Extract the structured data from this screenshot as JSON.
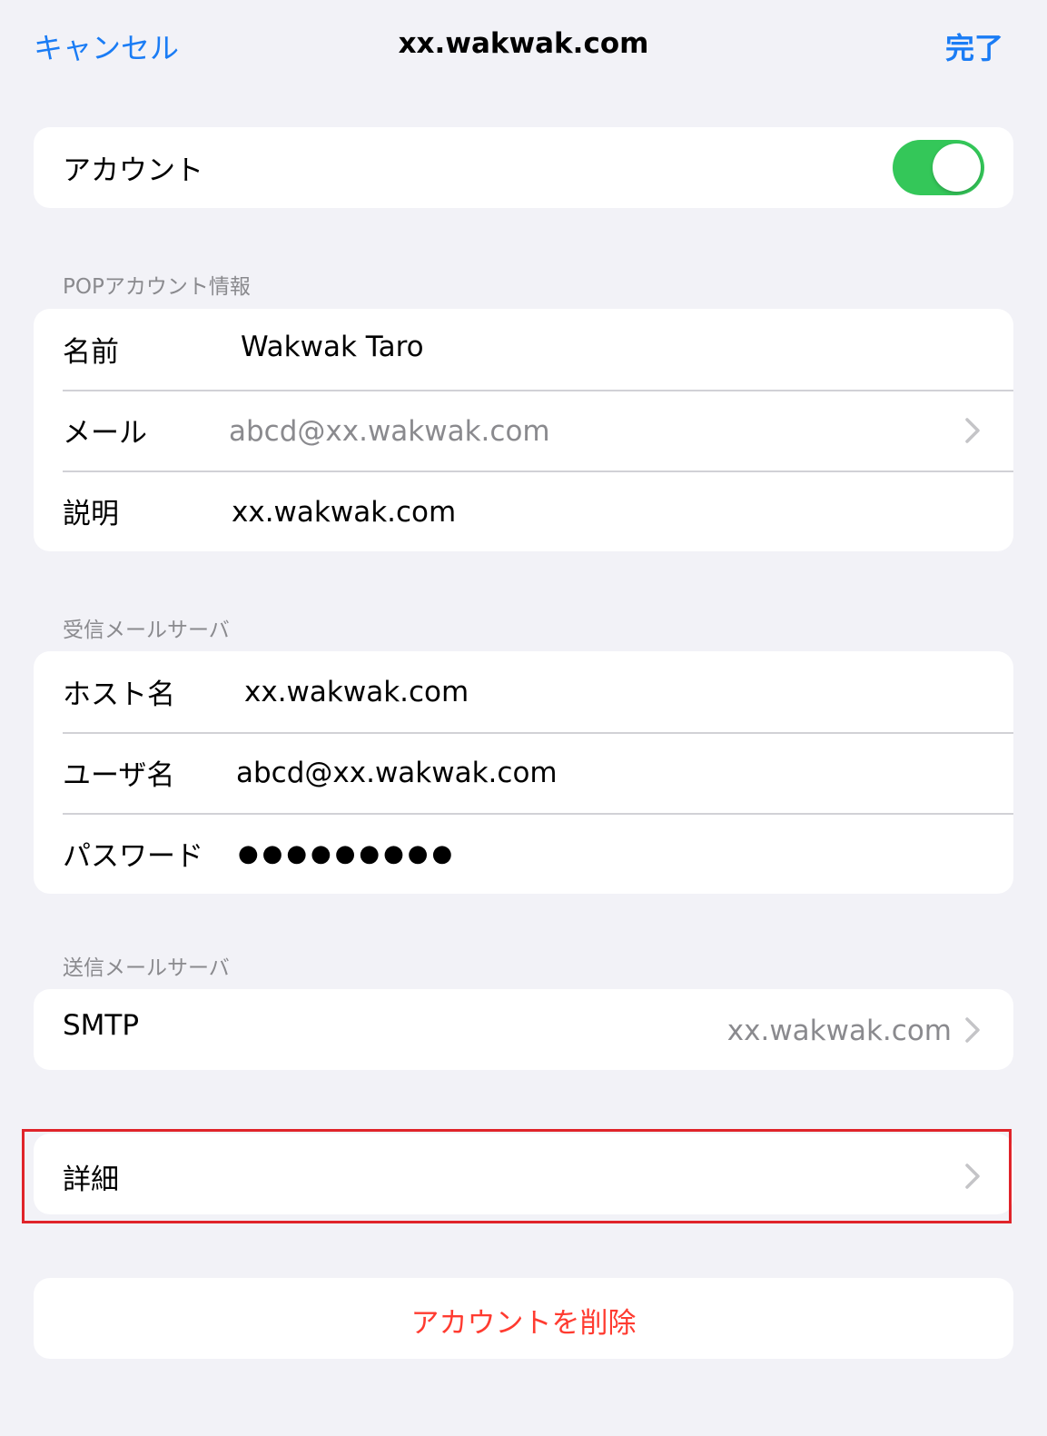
{
  "nav": {
    "cancel": "キャンセル",
    "title": "xx.wakwak.com",
    "done": "完了"
  },
  "account": {
    "label": "アカウント",
    "enabled": true
  },
  "pop_section": {
    "header": "POPアカウント情報",
    "name_label": "名前",
    "name_value": "Wakwak Taro",
    "mail_label": "メール",
    "mail_value": "abcd@xx.wakwak.com",
    "desc_label": "説明",
    "desc_value": "xx.wakwak.com"
  },
  "incoming": {
    "header": "受信メールサーバ",
    "host_label": "ホスト名",
    "host_value": "xx.wakwak.com",
    "user_label": "ユーザ名",
    "user_value": "abcd@xx.wakwak.com",
    "password_label": "パスワード",
    "password_value": "●●●●●●●●●"
  },
  "outgoing": {
    "header": "送信メールサーバ",
    "smtp_label": "SMTP",
    "smtp_value": "xx.wakwak.com"
  },
  "advanced": {
    "label": "詳細"
  },
  "delete_label": "アカウントを削除",
  "colors": {
    "accent": "#1a7cf5",
    "toggle_on": "#34c759",
    "destructive": "#ff3b30",
    "highlight": "#e0242a"
  }
}
